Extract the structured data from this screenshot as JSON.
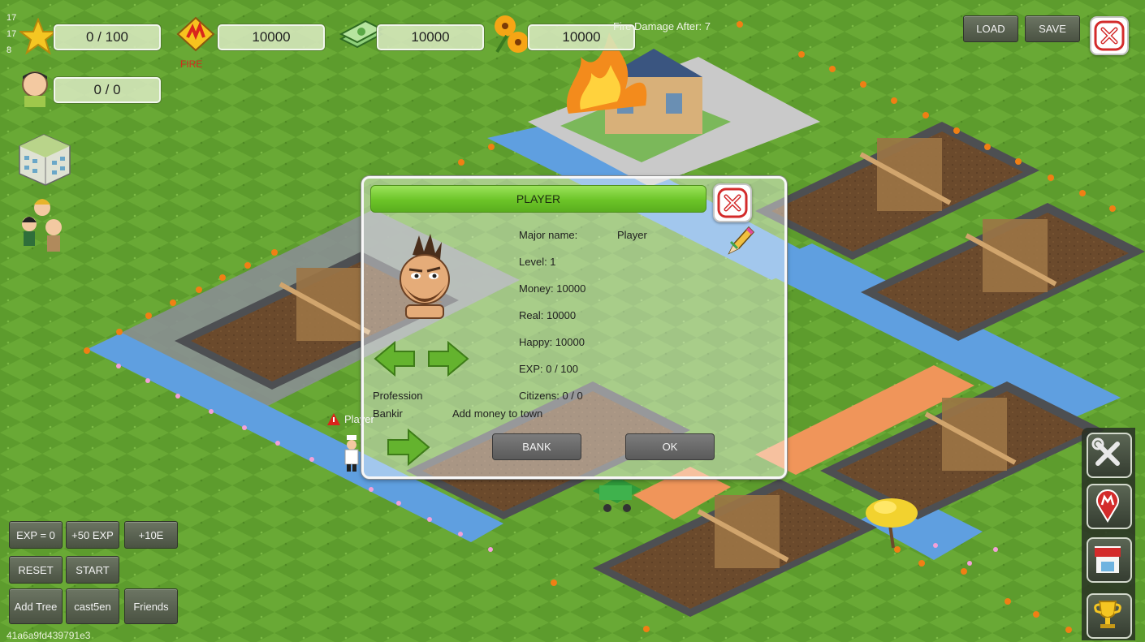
{
  "colors": {
    "grass": "#5b9a2c",
    "road_blue": "#5f9fe0",
    "road_orange": "#f0955a",
    "dialog_header": "#7ccd34",
    "close_red": "#d32b2b"
  },
  "debug": {
    "line1": "17",
    "line2": "17",
    "line3": "8",
    "id_string": "41a6a9fd439791e3"
  },
  "hud": {
    "exp": {
      "icon": "star-icon",
      "value": "0 / 100"
    },
    "fire": {
      "icon": "fire-badge-icon",
      "value": "10000",
      "label": "FIRE"
    },
    "money": {
      "icon": "money-stack-icon",
      "value": "10000"
    },
    "flowers": {
      "icon": "lily-flower-icon",
      "value": "10000"
    },
    "citizens": {
      "icon": "citizen-face-icon",
      "value": "0 / 0"
    },
    "fire_damage": "Fire Damage After: 7"
  },
  "top_buttons": {
    "load": "LOAD",
    "save": "SAVE"
  },
  "world": {
    "player_tag": "Player"
  },
  "dialog": {
    "title": "PLAYER",
    "major_name_label": "Major name:",
    "major_name_value": "Player",
    "level": "Level: 1",
    "money": "Money: 10000",
    "real": "Real: 10000",
    "happy": "Happy: 10000",
    "exp": "EXP: 0 / 100",
    "citizens": "Citizens: 0 / 0",
    "profession_label": "Profession",
    "profession_value": "Bankir",
    "profession_desc": "Add money to town",
    "bank_button": "BANK",
    "ok_button": "OK"
  },
  "debug_buttons": {
    "exp_zero": "EXP = 0",
    "plus50": "+50 EXP",
    "plus10": "+10E",
    "reset": "RESET",
    "start": "START",
    "add_tree": "Add Tree",
    "cast": "cast5en",
    "friends": "Friends"
  },
  "side_toolbar": [
    "tools-icon",
    "map-pin-icon",
    "shop-icon",
    "trophy-icon"
  ]
}
